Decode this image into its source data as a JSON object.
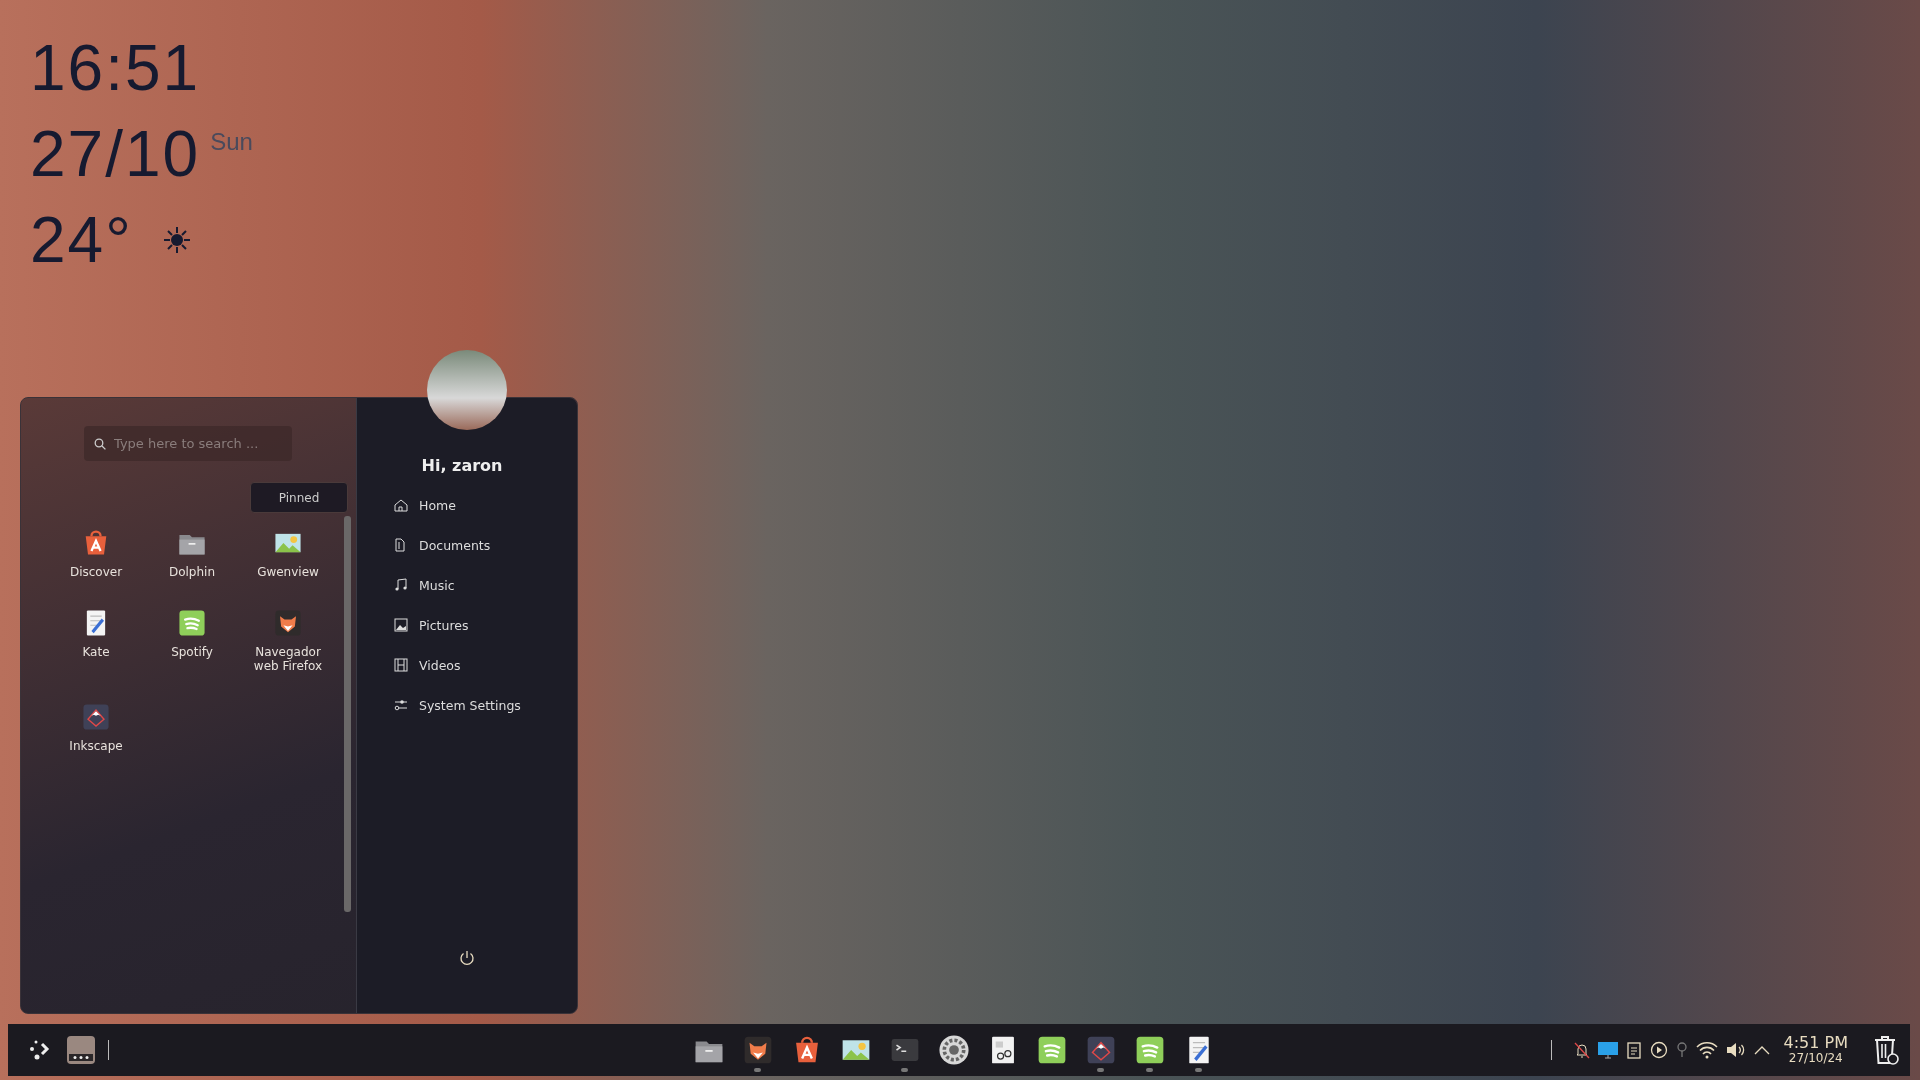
{
  "clock_widget": {
    "time": "16:51",
    "date": "27/10",
    "weekday": "Sun",
    "temperature": "24°"
  },
  "menu": {
    "search": {
      "placeholder": "Type here to search ..."
    },
    "tabs": [
      {
        "label": "Pinned",
        "selected": true
      }
    ],
    "pinned_apps": [
      {
        "label": "Discover"
      },
      {
        "label": "Dolphin"
      },
      {
        "label": "Gwenview"
      },
      {
        "label": "Kate"
      },
      {
        "label": "Spotify"
      },
      {
        "label": "Navegador web Firefox"
      },
      {
        "label": "Inkscape"
      }
    ],
    "greeting": "Hi, zaron",
    "places": [
      {
        "label": "Home"
      },
      {
        "label": "Documents"
      },
      {
        "label": "Music"
      },
      {
        "label": "Pictures"
      },
      {
        "label": "Videos"
      },
      {
        "label": "System Settings"
      }
    ]
  },
  "taskbar": {
    "apps": [
      {
        "running": false
      },
      {
        "running": true
      },
      {
        "running": false
      },
      {
        "running": false
      },
      {
        "running": true
      },
      {
        "running": false
      },
      {
        "running": false
      },
      {
        "running": false
      },
      {
        "running": true
      },
      {
        "running": true
      },
      {
        "running": true
      }
    ],
    "clock": {
      "time": "4:51 PM",
      "date": "27/10/24"
    }
  }
}
